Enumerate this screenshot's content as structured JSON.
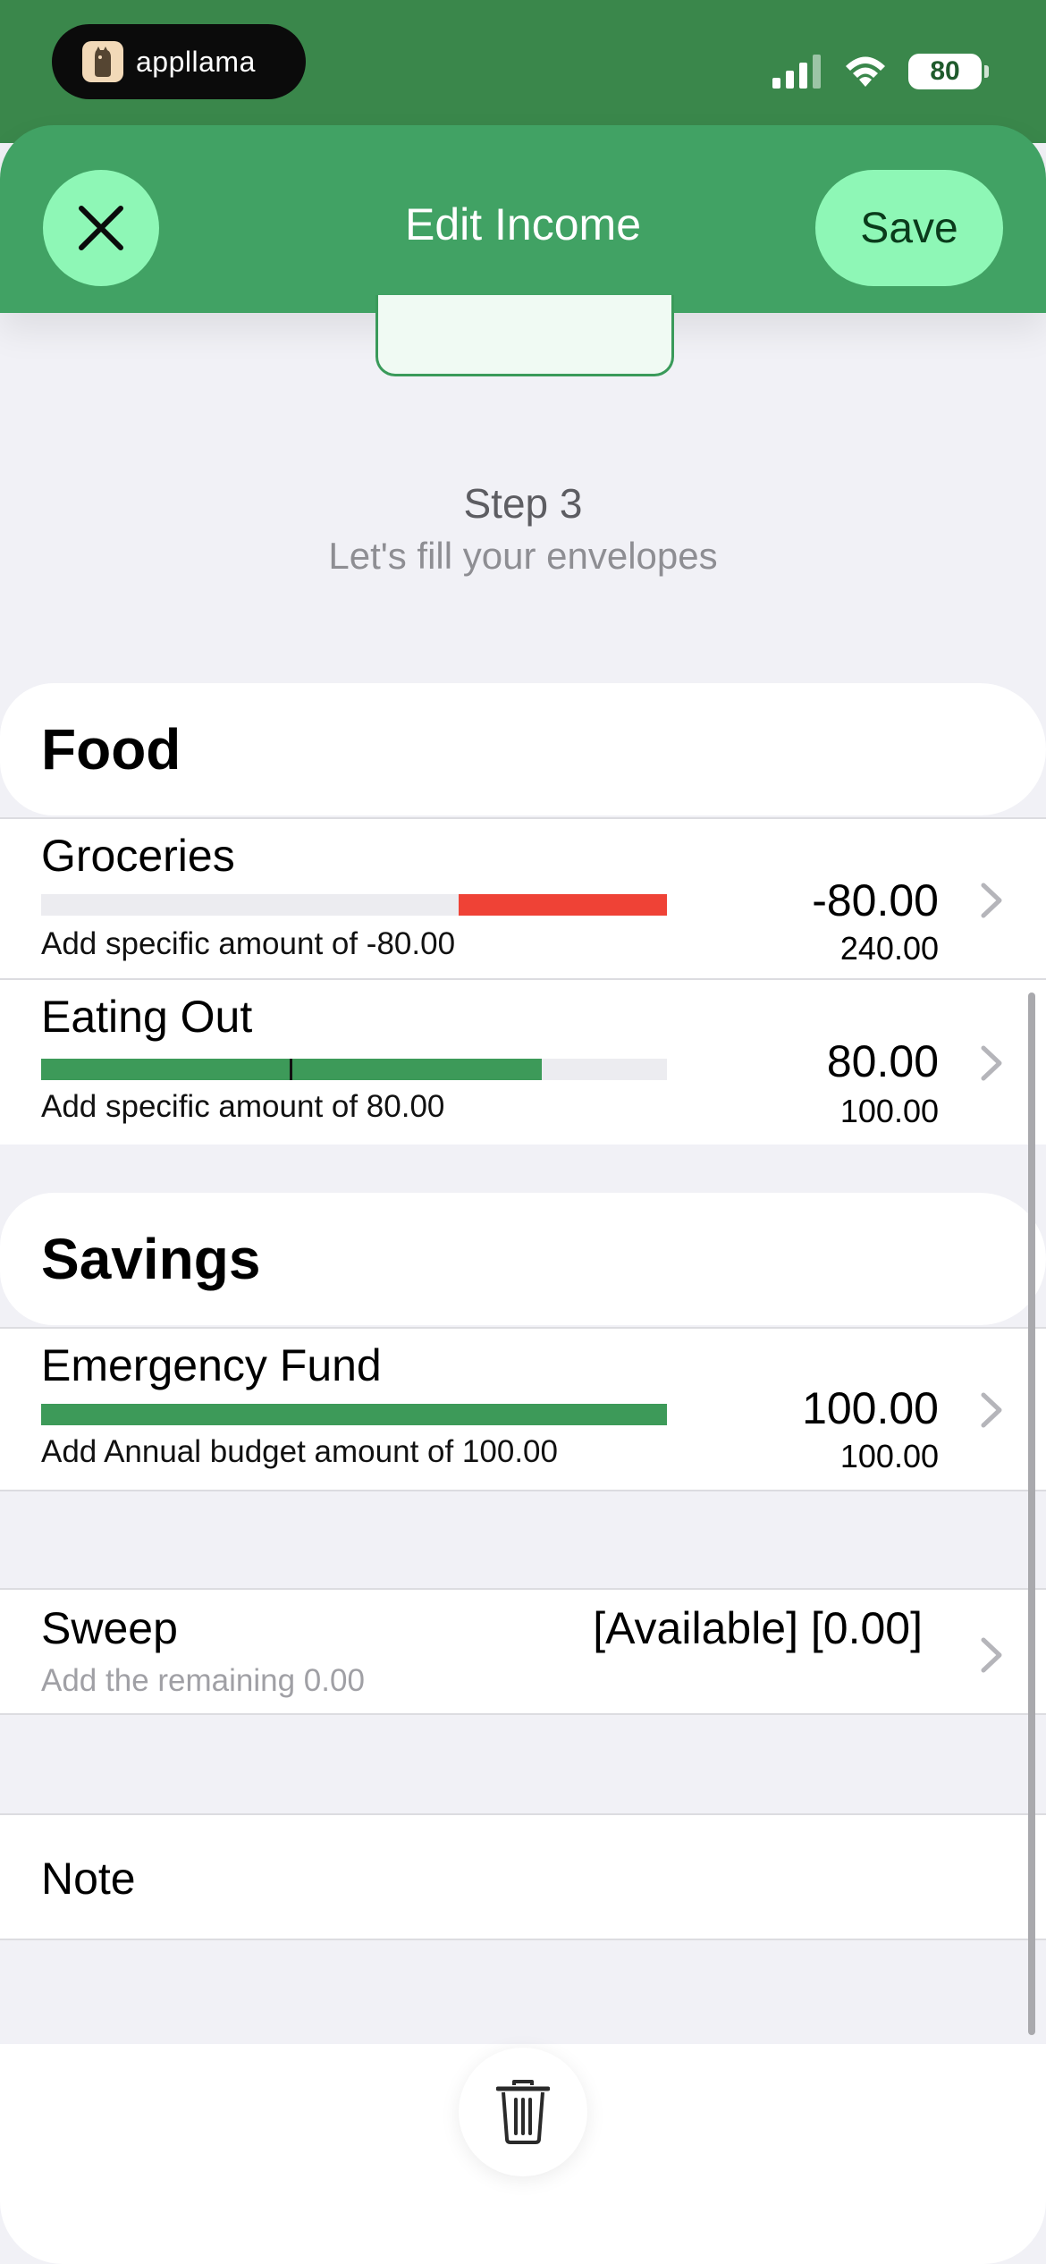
{
  "status": {
    "app_name": "appllama",
    "battery": "80"
  },
  "nav": {
    "title": "Edit Income",
    "save_label": "Save"
  },
  "step": {
    "title": "Step 3",
    "subtitle": "Let's fill your envelopes"
  },
  "sections": [
    {
      "title": "Food",
      "items": [
        {
          "name": "Groceries",
          "desc": "Add specific amount of -80.00",
          "amount": "-80.00",
          "budget": "240.00",
          "fill_start": 0.667,
          "fill_end": 1.0,
          "fill_color": "#ef4236"
        },
        {
          "name": "Eating Out",
          "desc": "Add specific amount of 80.00",
          "amount": "80.00",
          "budget": "100.00",
          "fill_start": 0.0,
          "fill_end": 0.8,
          "fill_color": "#3d9a59"
        }
      ]
    },
    {
      "title": "Savings",
      "items": [
        {
          "name": "Emergency Fund",
          "desc": "Add Annual budget amount of 100.00",
          "amount": "100.00",
          "budget": "100.00",
          "fill_start": 0.0,
          "fill_end": 1.0,
          "fill_color": "#3d9a59"
        }
      ]
    }
  ],
  "sweep": {
    "title": "Sweep",
    "value": "[Available] [0.00]",
    "desc": "Add the remaining 0.00"
  },
  "note": {
    "label": "Note"
  },
  "icons": {
    "close": "close-icon",
    "trash": "trash-icon",
    "chevron": "chevron-right-icon"
  }
}
